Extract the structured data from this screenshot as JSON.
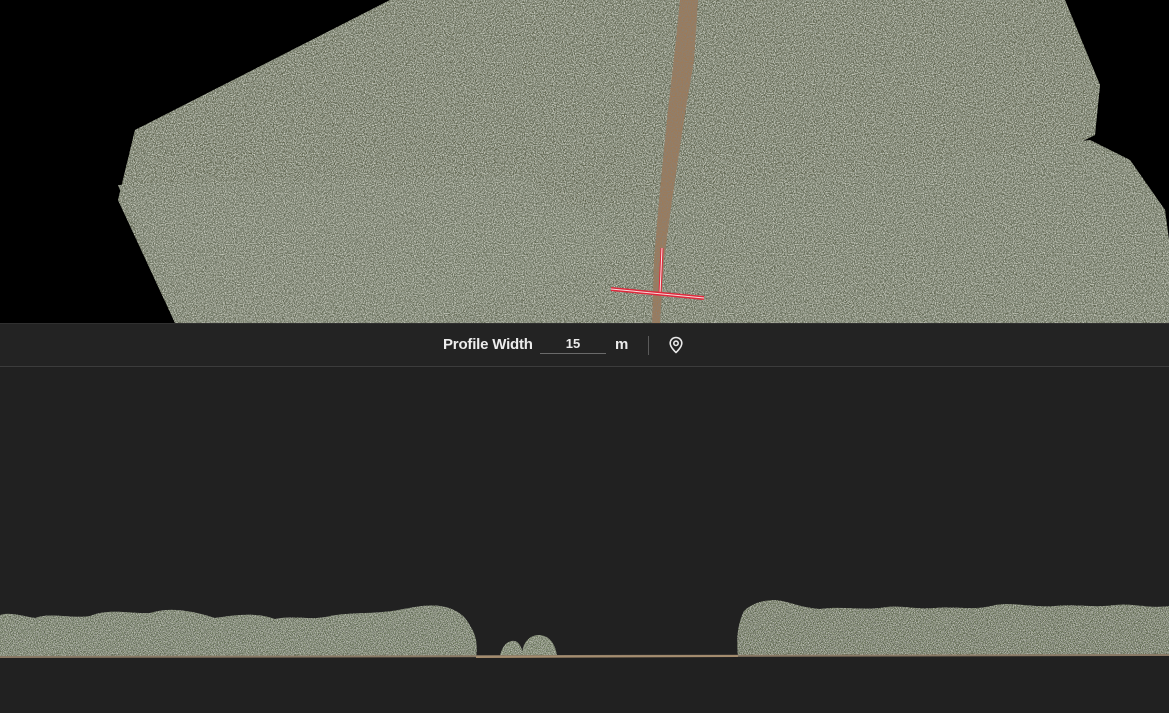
{
  "profile_toolbar": {
    "label": "Profile Width",
    "width_value": "15",
    "unit": "m",
    "pin_icon": "map-pin-icon"
  },
  "viewport": {
    "background_color": "#000000",
    "canopy_color": "#5a6048",
    "road_color": "#9c7a58",
    "profile_line_color": "#e0283c"
  },
  "profile_panel": {
    "background_color": "#212121",
    "ground_color": "#8a7a66",
    "canopy_color": "#5c6a4c"
  }
}
